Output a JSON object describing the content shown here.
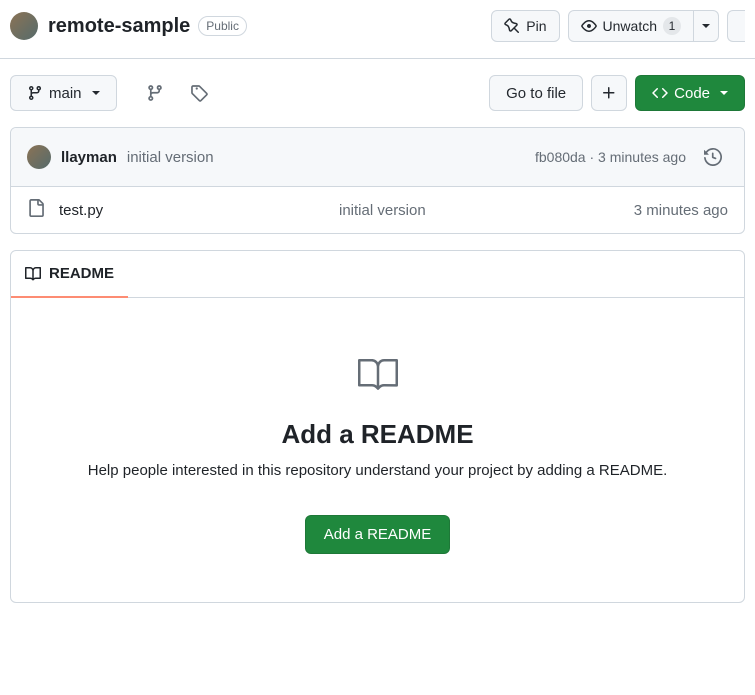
{
  "header": {
    "repo_name": "remote-sample",
    "visibility": "Public",
    "pin_label": "Pin",
    "watch_label": "Unwatch",
    "watch_count": "1"
  },
  "toolbar": {
    "branch_label": "main",
    "go_to_file_label": "Go to file",
    "code_label": "Code"
  },
  "commit": {
    "author": "llayman",
    "message": "initial version",
    "sha": "fb080da",
    "sep": " · ",
    "time": "3 minutes ago"
  },
  "files": [
    {
      "name": "test.py",
      "commit_message": "initial version",
      "time": "3 minutes ago"
    }
  ],
  "readme": {
    "tab_label": "README",
    "title": "Add a README",
    "description": "Help people interested in this repository understand your project by adding a README.",
    "button_label": "Add a README"
  }
}
